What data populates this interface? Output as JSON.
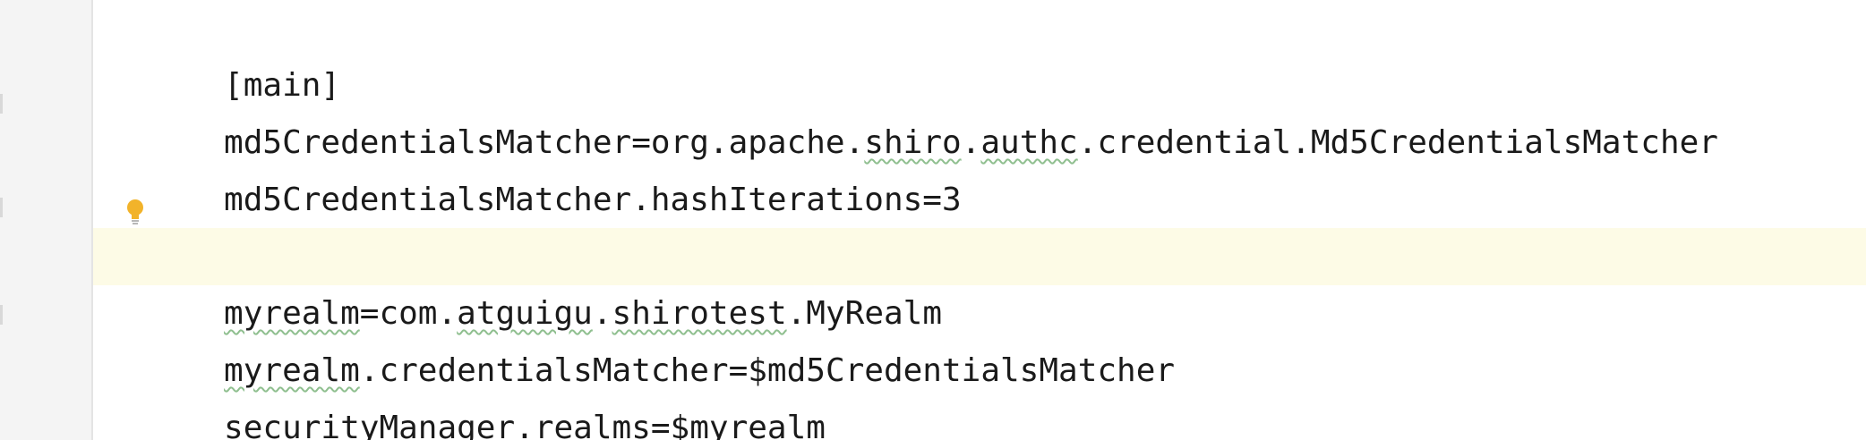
{
  "editor": {
    "lines": [
      {
        "text": "[main]"
      },
      {
        "segments": [
          "md5CredentialsMatcher=org.apache.",
          "shiro",
          ".",
          "authc",
          ".credential.Md5CredentialsMatcher"
        ]
      },
      {
        "text": "md5CredentialsMatcher.hashIterations=3"
      },
      {
        "text": ""
      },
      {
        "segments": [
          "myrealm",
          "=com.",
          "atguigu",
          ".",
          "shirotest",
          ".MyRealm"
        ]
      },
      {
        "segments": [
          "myrealm",
          ".credentialsMatcher=$md5CredentialsMatcher"
        ]
      },
      {
        "segments": [
          "securityManager.realms=$",
          "myrealm"
        ]
      }
    ],
    "intention_icon": "lightbulb-icon",
    "highlight_color": "#fdfbe6"
  }
}
